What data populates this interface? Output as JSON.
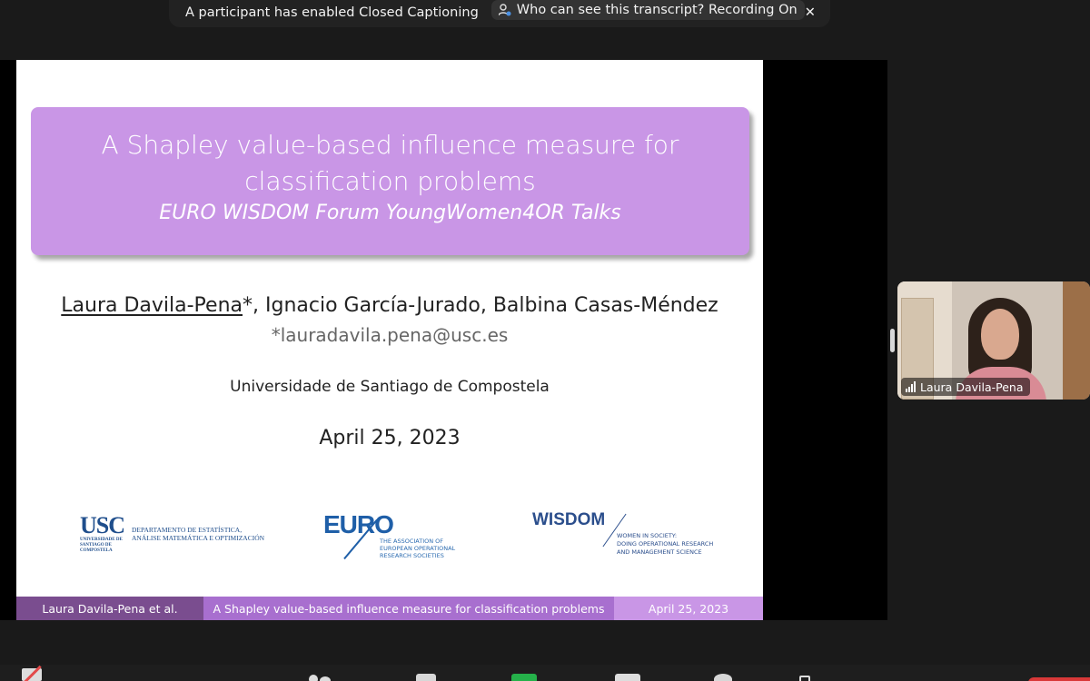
{
  "notification": {
    "text": "A participant has enabled Closed Captioning",
    "transcript_pill": "Who can see this transcript? Recording On",
    "close_glyph": "✕",
    "icons": [
      "user-lock-icon",
      "close-icon"
    ]
  },
  "slide": {
    "title_line1": "A Shapley value-based influence measure for",
    "title_line2": "classification problems",
    "subtitle": "EURO WISDOM Forum YoungWomen4OR Talks",
    "presenter": "Laura Davila-Pena",
    "presenter_mark": "*",
    "coauthors": ", Ignacio García-Jurado, Balbina Casas-Méndez",
    "email": "*lauradavila.pena@usc.es",
    "university": "Universidade de Santiago de Compostela",
    "date": "April 25, 2023",
    "logos": {
      "usc_mark": "USC",
      "usc_sub": "UNIVERSIDADE DE SANTIAGO DE COMPOSTELA",
      "usc_dept_line1": "DEPARTAMENTO DE ESTATÍSTICA,",
      "usc_dept_line2": "ANÁLISE MATEMÁTICA E OPTIMIZACIÓN",
      "euro_mark": "EURO",
      "euro_sub_line1": "THE ASSOCIATION OF",
      "euro_sub_line2": "EUROPEAN OPERATIONAL",
      "euro_sub_line3": "RESEARCH SOCIETIES",
      "wisdom_mark": "WISDOM",
      "wisdom_sub_line1": "WOMEN IN SOCIETY:",
      "wisdom_sub_line2": "DOING OPERATIONAL RESEARCH",
      "wisdom_sub_line3": "AND MANAGEMENT SCIENCE"
    },
    "footer": {
      "left": "Laura Davila-Pena et al.",
      "middle": "A Shapley value-based influence measure for classification problems",
      "right": "April 25, 2023"
    },
    "colors": {
      "title_box": "#c996e6",
      "footer_left": "#7a4d8f",
      "footer_mid": "#a86fcf",
      "footer_right": "#c996e6"
    }
  },
  "participant": {
    "name": "Laura Davila-Pena",
    "icons": [
      "signal-strength-icon"
    ]
  },
  "toolbar": {
    "icons": [
      "video-off-icon",
      "participants-icon",
      "chat-icon",
      "share-screen-icon",
      "record-icon",
      "reactions-icon",
      "apps-icon",
      "end-meeting-button"
    ],
    "colors": {
      "share": "#25b14a",
      "end": "#d93838",
      "video_off_slash": "#e24a4a"
    }
  }
}
